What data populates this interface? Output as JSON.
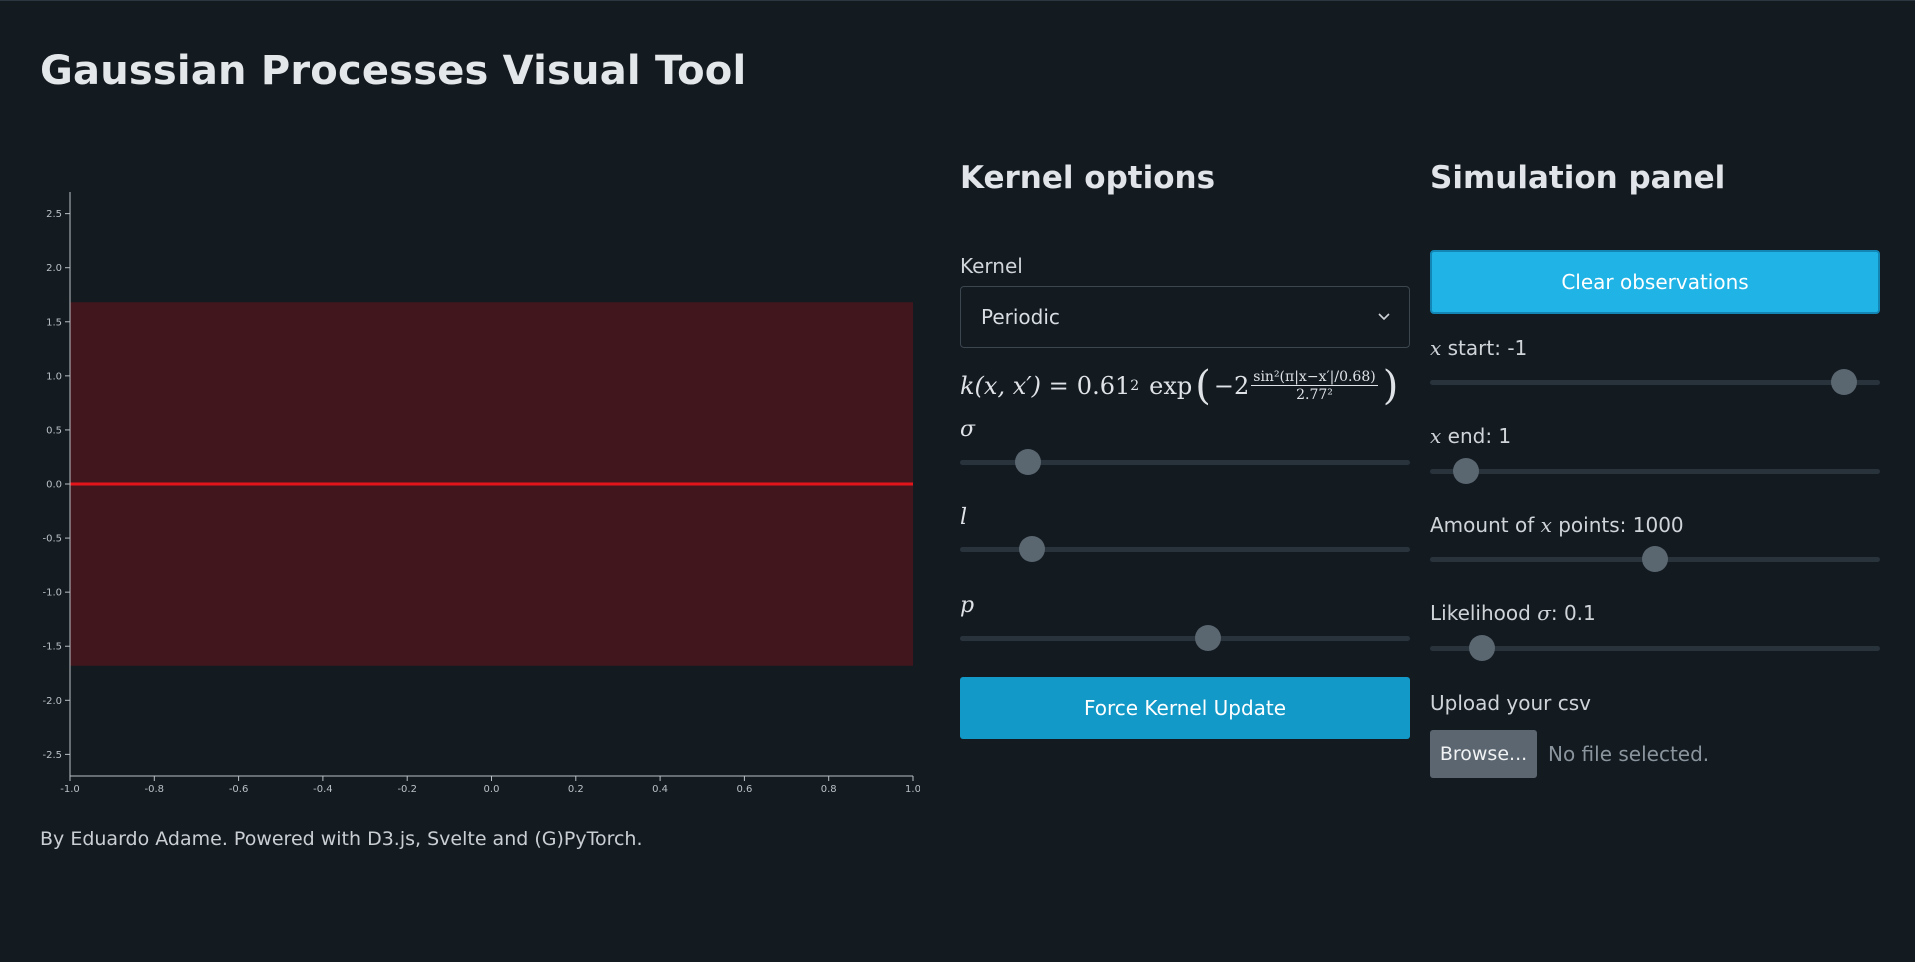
{
  "page": {
    "title": "Gaussian Processes Visual Tool"
  },
  "footer": {
    "text": "By Eduardo Adame. Powered with D3.js, Svelte and (G)PyTorch."
  },
  "chart_data": {
    "type": "area",
    "x_ticks": [
      "-1.0",
      "-0.8",
      "-0.6",
      "-0.4",
      "-0.2",
      "0.0",
      "0.2",
      "0.4",
      "0.6",
      "0.8",
      "1.0"
    ],
    "y_ticks": [
      "2.5",
      "2.0",
      "1.5",
      "1.0",
      "0.5",
      "0.0",
      "-0.5",
      "-1.0",
      "-1.5",
      "-2.0",
      "-2.5"
    ],
    "xlim": [
      -1,
      1
    ],
    "ylim": [
      -2.7,
      2.7
    ],
    "series": [
      {
        "kind": "confidence_band",
        "x": [
          -1,
          1
        ],
        "upper": [
          1.68,
          1.68
        ],
        "lower": [
          -1.68,
          -1.68
        ],
        "color": "#42161d"
      },
      {
        "kind": "mean_line",
        "x": [
          -1,
          1
        ],
        "y": [
          0.0,
          0.0
        ],
        "color": "#e3151b"
      }
    ]
  },
  "kernel": {
    "title": "Kernel options",
    "select_label": "Kernel",
    "selected": "Periodic",
    "formula": {
      "lhs": "k(x, x′) = ",
      "coef": "0.61",
      "coef_sup": "2",
      "exp": "exp",
      "minus": "−2",
      "num": "sin²(π|x−x′|/0.68)",
      "den": "2.77²"
    },
    "params": [
      {
        "symbol": "σ",
        "value": 0.15
      },
      {
        "symbol": "l",
        "value": 0.16
      },
      {
        "symbol": "p",
        "value": 0.55
      }
    ],
    "update_button": "Force Kernel Update"
  },
  "simulation": {
    "title": "Simulation panel",
    "clear_button": "Clear observations",
    "sliders": [
      {
        "var": "x",
        "label_suffix": " start: -1",
        "value": 0.92
      },
      {
        "var": "x",
        "label_suffix": " end: 1",
        "value": 0.08
      },
      {
        "prefix": "Amount of ",
        "var": "x",
        "label_suffix": " points: 1000",
        "value": 0.5
      },
      {
        "prefix": "Likelihood ",
        "var": "σ",
        "label_suffix": ": 0.1",
        "value": 0.115
      }
    ],
    "upload_label": "Upload your csv",
    "browse_button": "Browse...",
    "file_status": "No file selected."
  },
  "colors": {
    "background": "#131a20",
    "primary_button": "#1299c8",
    "clear_button": "#1fb3e6",
    "band": "#42161d",
    "mean_line": "#e3151b"
  }
}
